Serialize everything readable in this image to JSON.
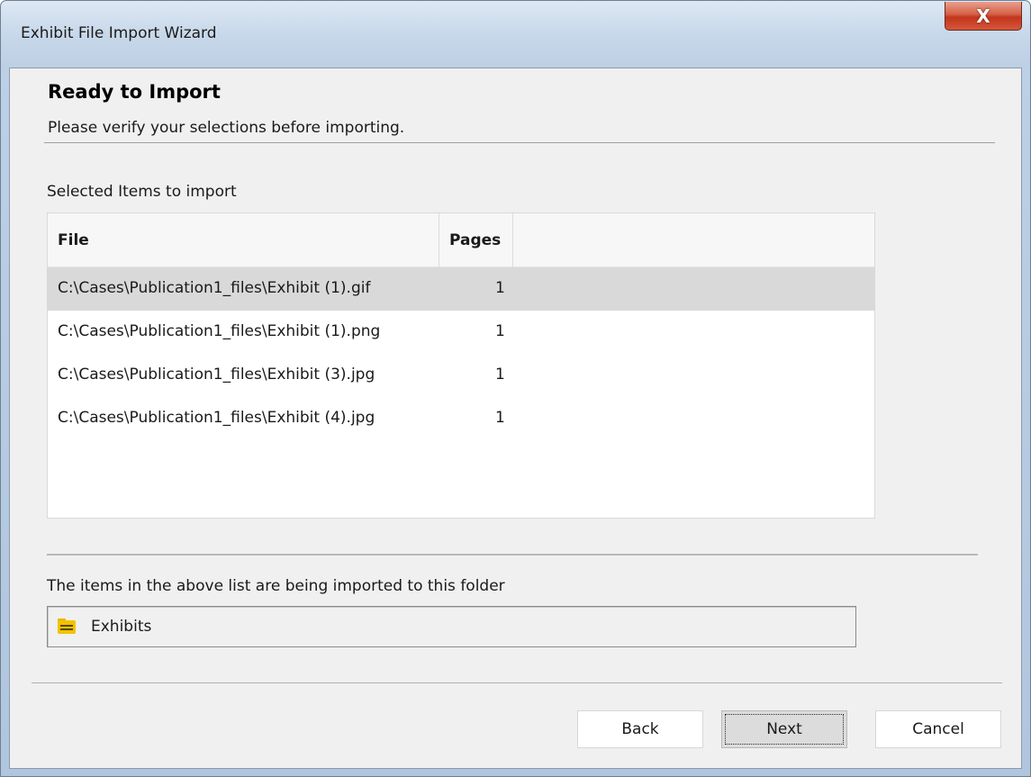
{
  "window": {
    "title": "Exhibit File Import Wizard",
    "close_glyph": "X"
  },
  "page": {
    "heading": "Ready to Import",
    "subheading": "Please verify your selections before importing."
  },
  "list": {
    "label": "Selected Items to import",
    "columns": {
      "file": "File",
      "pages": "Pages"
    },
    "rows": [
      {
        "file": "C:\\Cases\\Publication1_files\\Exhibit (1).gif",
        "pages": "1",
        "selected": true
      },
      {
        "file": "C:\\Cases\\Publication1_files\\Exhibit (1).png",
        "pages": "1",
        "selected": false
      },
      {
        "file": "C:\\Cases\\Publication1_files\\Exhibit (3).jpg",
        "pages": "1",
        "selected": false
      },
      {
        "file": "C:\\Cases\\Publication1_files\\Exhibit (4).jpg",
        "pages": "1",
        "selected": false
      }
    ]
  },
  "destination": {
    "label": "The items in the above list are being imported to this folder",
    "folder_name": "Exhibits",
    "folder_icon": "folder-icon",
    "folder_icon_color": "#f2c200"
  },
  "buttons": {
    "back": "Back",
    "next": "Next",
    "cancel": "Cancel"
  },
  "colors": {
    "selected_row": "#d9d9d9",
    "close_button": "#c8412a"
  }
}
